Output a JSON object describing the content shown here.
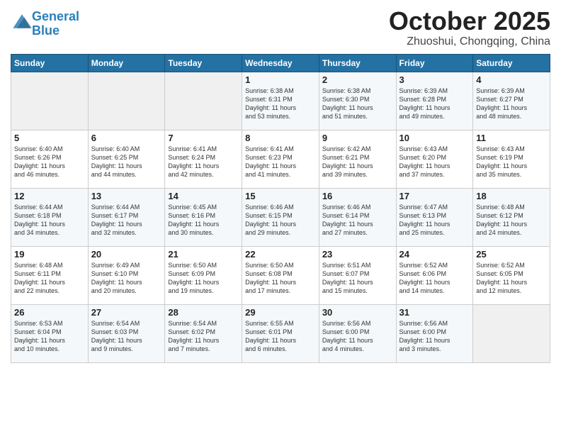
{
  "header": {
    "logo_line1": "General",
    "logo_line2": "Blue",
    "title": "October 2025",
    "location": "Zhuoshui, Chongqing, China"
  },
  "weekdays": [
    "Sunday",
    "Monday",
    "Tuesday",
    "Wednesday",
    "Thursday",
    "Friday",
    "Saturday"
  ],
  "weeks": [
    [
      {
        "day": "",
        "text": ""
      },
      {
        "day": "",
        "text": ""
      },
      {
        "day": "",
        "text": ""
      },
      {
        "day": "1",
        "text": "Sunrise: 6:38 AM\nSunset: 6:31 PM\nDaylight: 11 hours\nand 53 minutes."
      },
      {
        "day": "2",
        "text": "Sunrise: 6:38 AM\nSunset: 6:30 PM\nDaylight: 11 hours\nand 51 minutes."
      },
      {
        "day": "3",
        "text": "Sunrise: 6:39 AM\nSunset: 6:28 PM\nDaylight: 11 hours\nand 49 minutes."
      },
      {
        "day": "4",
        "text": "Sunrise: 6:39 AM\nSunset: 6:27 PM\nDaylight: 11 hours\nand 48 minutes."
      }
    ],
    [
      {
        "day": "5",
        "text": "Sunrise: 6:40 AM\nSunset: 6:26 PM\nDaylight: 11 hours\nand 46 minutes."
      },
      {
        "day": "6",
        "text": "Sunrise: 6:40 AM\nSunset: 6:25 PM\nDaylight: 11 hours\nand 44 minutes."
      },
      {
        "day": "7",
        "text": "Sunrise: 6:41 AM\nSunset: 6:24 PM\nDaylight: 11 hours\nand 42 minutes."
      },
      {
        "day": "8",
        "text": "Sunrise: 6:41 AM\nSunset: 6:23 PM\nDaylight: 11 hours\nand 41 minutes."
      },
      {
        "day": "9",
        "text": "Sunrise: 6:42 AM\nSunset: 6:21 PM\nDaylight: 11 hours\nand 39 minutes."
      },
      {
        "day": "10",
        "text": "Sunrise: 6:43 AM\nSunset: 6:20 PM\nDaylight: 11 hours\nand 37 minutes."
      },
      {
        "day": "11",
        "text": "Sunrise: 6:43 AM\nSunset: 6:19 PM\nDaylight: 11 hours\nand 35 minutes."
      }
    ],
    [
      {
        "day": "12",
        "text": "Sunrise: 6:44 AM\nSunset: 6:18 PM\nDaylight: 11 hours\nand 34 minutes."
      },
      {
        "day": "13",
        "text": "Sunrise: 6:44 AM\nSunset: 6:17 PM\nDaylight: 11 hours\nand 32 minutes."
      },
      {
        "day": "14",
        "text": "Sunrise: 6:45 AM\nSunset: 6:16 PM\nDaylight: 11 hours\nand 30 minutes."
      },
      {
        "day": "15",
        "text": "Sunrise: 6:46 AM\nSunset: 6:15 PM\nDaylight: 11 hours\nand 29 minutes."
      },
      {
        "day": "16",
        "text": "Sunrise: 6:46 AM\nSunset: 6:14 PM\nDaylight: 11 hours\nand 27 minutes."
      },
      {
        "day": "17",
        "text": "Sunrise: 6:47 AM\nSunset: 6:13 PM\nDaylight: 11 hours\nand 25 minutes."
      },
      {
        "day": "18",
        "text": "Sunrise: 6:48 AM\nSunset: 6:12 PM\nDaylight: 11 hours\nand 24 minutes."
      }
    ],
    [
      {
        "day": "19",
        "text": "Sunrise: 6:48 AM\nSunset: 6:11 PM\nDaylight: 11 hours\nand 22 minutes."
      },
      {
        "day": "20",
        "text": "Sunrise: 6:49 AM\nSunset: 6:10 PM\nDaylight: 11 hours\nand 20 minutes."
      },
      {
        "day": "21",
        "text": "Sunrise: 6:50 AM\nSunset: 6:09 PM\nDaylight: 11 hours\nand 19 minutes."
      },
      {
        "day": "22",
        "text": "Sunrise: 6:50 AM\nSunset: 6:08 PM\nDaylight: 11 hours\nand 17 minutes."
      },
      {
        "day": "23",
        "text": "Sunrise: 6:51 AM\nSunset: 6:07 PM\nDaylight: 11 hours\nand 15 minutes."
      },
      {
        "day": "24",
        "text": "Sunrise: 6:52 AM\nSunset: 6:06 PM\nDaylight: 11 hours\nand 14 minutes."
      },
      {
        "day": "25",
        "text": "Sunrise: 6:52 AM\nSunset: 6:05 PM\nDaylight: 11 hours\nand 12 minutes."
      }
    ],
    [
      {
        "day": "26",
        "text": "Sunrise: 6:53 AM\nSunset: 6:04 PM\nDaylight: 11 hours\nand 10 minutes."
      },
      {
        "day": "27",
        "text": "Sunrise: 6:54 AM\nSunset: 6:03 PM\nDaylight: 11 hours\nand 9 minutes."
      },
      {
        "day": "28",
        "text": "Sunrise: 6:54 AM\nSunset: 6:02 PM\nDaylight: 11 hours\nand 7 minutes."
      },
      {
        "day": "29",
        "text": "Sunrise: 6:55 AM\nSunset: 6:01 PM\nDaylight: 11 hours\nand 6 minutes."
      },
      {
        "day": "30",
        "text": "Sunrise: 6:56 AM\nSunset: 6:00 PM\nDaylight: 11 hours\nand 4 minutes."
      },
      {
        "day": "31",
        "text": "Sunrise: 6:56 AM\nSunset: 6:00 PM\nDaylight: 11 hours\nand 3 minutes."
      },
      {
        "day": "",
        "text": ""
      }
    ]
  ]
}
